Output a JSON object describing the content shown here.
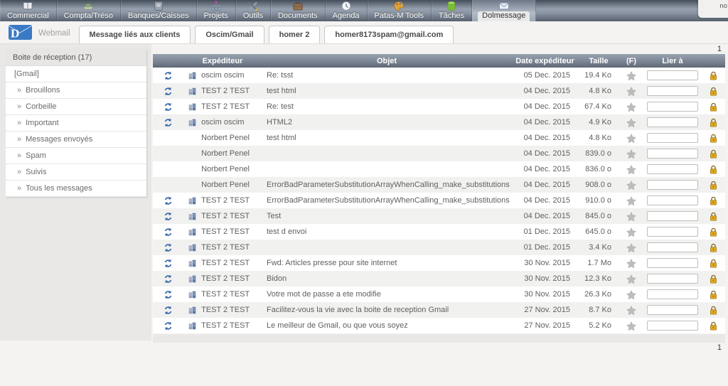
{
  "menubar": {
    "corner_text": "no",
    "items": [
      {
        "label": "Commercial",
        "icon": "book-icon",
        "active": false
      },
      {
        "label": "Compta/Tréso",
        "icon": "money-icon",
        "active": false
      },
      {
        "label": "Banques/Caisses",
        "icon": "safe-icon",
        "active": false
      },
      {
        "label": "Projets",
        "icon": "orgchart-icon",
        "active": false
      },
      {
        "label": "Outils",
        "icon": "tools-icon",
        "active": false
      },
      {
        "label": "Documents",
        "icon": "briefcase-icon",
        "active": false
      },
      {
        "label": "Agenda",
        "icon": "clock-icon",
        "active": false
      },
      {
        "label": "Patas-M Tools",
        "icon": "paint-icon",
        "active": false
      },
      {
        "label": "Tâches",
        "icon": "tasks-icon",
        "active": false
      },
      {
        "label": "Dolmessage",
        "icon": "mail-icon",
        "active": true
      }
    ]
  },
  "header": {
    "app_label": "Webmail"
  },
  "tabs": [
    {
      "label": "Message liés aux clients"
    },
    {
      "label": "Oscim/Gmail"
    },
    {
      "label": "homer 2"
    },
    {
      "label": "homer8173spam@gmail.com"
    }
  ],
  "sidebar": {
    "header": "Boite de réception (17)",
    "items": [
      {
        "label": "[Gmail]",
        "arrow": false
      },
      {
        "label": "Brouillons",
        "arrow": true
      },
      {
        "label": "Corbeille",
        "arrow": true
      },
      {
        "label": "Important",
        "arrow": true
      },
      {
        "label": "Messages envoyés",
        "arrow": true
      },
      {
        "label": "Spam",
        "arrow": true
      },
      {
        "label": "Suivis",
        "arrow": true
      },
      {
        "label": "Tous les messages",
        "arrow": true
      }
    ]
  },
  "table": {
    "columns": [
      "Expéditeur",
      "Objet",
      "Date expéditeur",
      "Taille",
      "(F)",
      "Lier à"
    ],
    "pagination_top": "1",
    "pagination_bottom": "1",
    "rows": [
      {
        "sync": true,
        "company": true,
        "sender": "oscim oscim",
        "subject": "Re: tsst",
        "date": "05 Dec. 2015",
        "size": "19.4 Ko",
        "link_value": ""
      },
      {
        "sync": true,
        "company": true,
        "sender": "TEST 2 TEST",
        "subject": "test html",
        "date": "04 Dec. 2015",
        "size": "4.8 Ko",
        "link_value": ""
      },
      {
        "sync": true,
        "company": true,
        "sender": "TEST 2 TEST",
        "subject": "Re: test",
        "date": "04 Dec. 2015",
        "size": "67.4 Ko",
        "link_value": ""
      },
      {
        "sync": true,
        "company": true,
        "sender": "oscim oscim",
        "subject": "HTML2",
        "date": "04 Dec. 2015",
        "size": "4.9 Ko",
        "link_value": ""
      },
      {
        "sync": false,
        "company": false,
        "sender": "Norbert Penel",
        "subject": "test html",
        "date": "04 Dec. 2015",
        "size": "4.8 Ko",
        "link_value": ""
      },
      {
        "sync": false,
        "company": false,
        "sender": "Norbert Penel",
        "subject": "",
        "date": "04 Dec. 2015",
        "size": "839.0 o",
        "link_value": ""
      },
      {
        "sync": false,
        "company": false,
        "sender": "Norbert Penel",
        "subject": "",
        "date": "04 Dec. 2015",
        "size": "836.0 o",
        "link_value": ""
      },
      {
        "sync": false,
        "company": false,
        "sender": "Norbert Penel",
        "subject": "ErrorBadParameterSubstitutionArrayWhenCalling_make_substitutions",
        "date": "04 Dec. 2015",
        "size": "908.0 o",
        "link_value": ""
      },
      {
        "sync": true,
        "company": true,
        "sender": "TEST 2 TEST",
        "subject": "ErrorBadParameterSubstitutionArrayWhenCalling_make_substitutions",
        "date": "04 Dec. 2015",
        "size": "910.0 o",
        "link_value": ""
      },
      {
        "sync": true,
        "company": true,
        "sender": "TEST 2 TEST",
        "subject": "Test",
        "date": "04 Dec. 2015",
        "size": "845.0 o",
        "link_value": ""
      },
      {
        "sync": true,
        "company": true,
        "sender": "TEST 2 TEST",
        "subject": "test d envoi",
        "date": "01 Dec. 2015",
        "size": "645.0 o",
        "link_value": ""
      },
      {
        "sync": true,
        "company": true,
        "sender": "TEST 2 TEST",
        "subject": "",
        "date": "01 Dec. 2015",
        "size": "3.4 Ko",
        "link_value": ""
      },
      {
        "sync": true,
        "company": true,
        "sender": "TEST 2 TEST",
        "subject": "Fwd: Articles presse pour site internet",
        "date": "30 Nov. 2015",
        "size": "1.7 Mo",
        "link_value": ""
      },
      {
        "sync": true,
        "company": true,
        "sender": "TEST 2 TEST",
        "subject": "Bidon",
        "date": "30 Nov. 2015",
        "size": "12.3 Ko",
        "link_value": ""
      },
      {
        "sync": true,
        "company": true,
        "sender": "TEST 2 TEST",
        "subject": "Votre mot de passe a ete modifie",
        "date": "30 Nov. 2015",
        "size": "26.3 Ko",
        "link_value": ""
      },
      {
        "sync": true,
        "company": true,
        "sender": "TEST 2 TEST",
        "subject": "Facilitez-vous la vie avec la boite de reception Gmail",
        "date": "27 Nov. 2015",
        "size": "8.7 Ko",
        "link_value": ""
      },
      {
        "sync": true,
        "company": true,
        "sender": "TEST 2 TEST",
        "subject": "Le meilleur de Gmail, ou que vous soyez",
        "date": "27 Nov. 2015",
        "size": "5.2 Ko",
        "link_value": ""
      }
    ]
  },
  "colors": {
    "accent_blue": "#3a79c4",
    "sync_blue": "#3465a8",
    "star_gray": "#bcbcbc",
    "lock_gold": "#e3aa1b",
    "header_gradient_top": "#99a2b0",
    "header_gradient_bottom": "#5e6876"
  }
}
